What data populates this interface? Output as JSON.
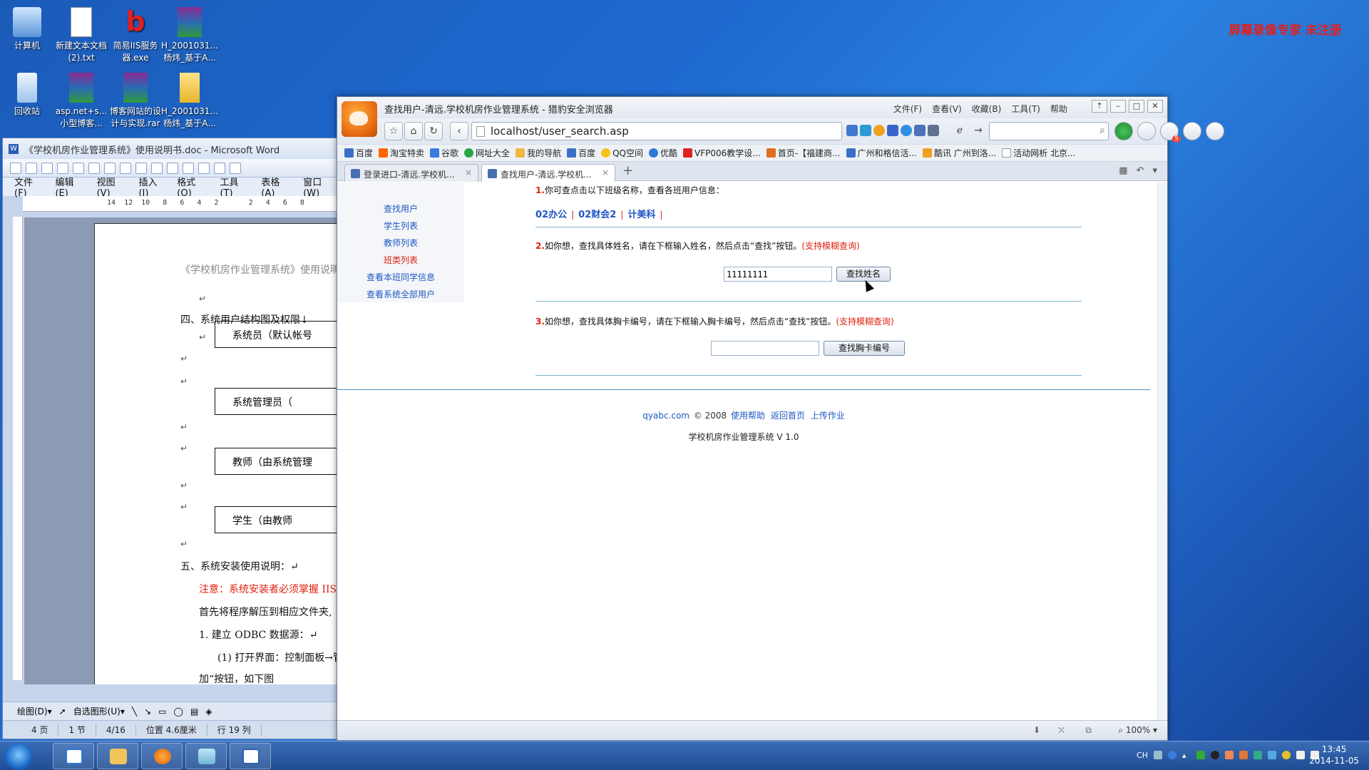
{
  "desktop": {
    "icons": [
      {
        "label": "计算机"
      },
      {
        "label": "新建文本文档\n(2).txt"
      },
      {
        "label": "简易IIS服务\n器.exe"
      },
      {
        "label": "H_2001031...\n杨炜_基于A..."
      },
      {
        "label": "回收站"
      },
      {
        "label": "asp.net+s...\n小型博客..."
      },
      {
        "label": "博客网站的设\n计与实现.rar"
      },
      {
        "label": "H_2001031...\n杨炜_基于A..."
      }
    ],
    "watermark": "屏幕录像专家  未注册"
  },
  "word": {
    "title": "《学校机房作业管理系统》使用说明书.doc - Microsoft Word",
    "menu": [
      "文件(F)",
      "编辑(E)",
      "视图(V)",
      "插入(I)",
      "格式(O)",
      "工具(T)",
      "表格(A)",
      "窗口(W)"
    ],
    "ruler": "14  12  10   8   6   4   2       2   4   6   8",
    "doc": {
      "header": "《学校机房作业管理系统》使用说明",
      "section4": "四、系统用户结构图及权限↓",
      "box1": "系统员（默认帐号",
      "box2": "系统管理员（",
      "box3": "教师（由系统管理",
      "box4": "学生（由教师",
      "section5": "五、系统安装使用说明：↵",
      "note": "注意：系统安装者必须掌握 IIS、",
      "para1": "首先将程序解压到相应文件夹,",
      "item1": "1.   建立 ODBC 数据源：↵",
      "item1a": "(1) 打开界面：控制面板→管",
      "item1b": "加“按钮，如下图",
      "ret": "↵"
    },
    "drawbar": [
      "绘图(D)▾",
      "自选图形(U)▾"
    ],
    "status": [
      "4 页",
      "1 节",
      "4/16",
      "位置 4.6厘米",
      "行  19 列"
    ]
  },
  "browser": {
    "title": "查找用户-清远.学校机房作业管理系统 - 猎豹安全浏览器",
    "menu": [
      "文件(F)",
      "查看(V)",
      "收藏(B)",
      "工具(T)",
      "帮助"
    ],
    "address": "localhost/user_search.asp",
    "bookmarks": [
      "百度",
      "淘宝特卖",
      "谷歌",
      "网址大全",
      "我的导航",
      "百度",
      "QQ空间",
      "优酷",
      "VFP006教学设...",
      "首页-【福建商...",
      "广州和格信活...",
      "酷讯 广州到洛...",
      "活动网析 北京..."
    ],
    "tabs": [
      {
        "label": "登录进口-清远.学校机..."
      },
      {
        "label": "查找用户-清远.学校机..."
      }
    ],
    "zoom": "100%",
    "download_badge": "5"
  },
  "page": {
    "sidenav": [
      "查找用户",
      "学生列表",
      "教师列表",
      "班类列表",
      "查看本班同学信息",
      "查看系统全部用户"
    ],
    "step1_num": "1.",
    "step1": "你可查点击以下班级名称，查看各班用户信息：",
    "classes": [
      "02办公",
      "02财会2",
      "计美科"
    ],
    "step2_num": "2.",
    "step2": "如你想，查找具体姓名，请在下框输入姓名，然后点击“查找”按钮。",
    "fuzzy": "(支持模糊查询)",
    "name_value": "11111111",
    "name_button": "查找姓名",
    "step3_num": "3.",
    "step3": "如你想，查找具体胸卡编号，请在下框输入胸卡编号，然后点击“查找”按钮。",
    "card_value": "",
    "card_button": "查找胸卡编号",
    "footer_site": "qyabc.com",
    "footer_copy": "© 2008",
    "footer_links": [
      "使用帮助",
      "返回首页",
      "上传作业"
    ],
    "footer_system": "学校机房作业管理系统 V 1.0"
  },
  "taskbar": {
    "time": "13:45",
    "date": "2014-11-05",
    "lang": "CH"
  }
}
